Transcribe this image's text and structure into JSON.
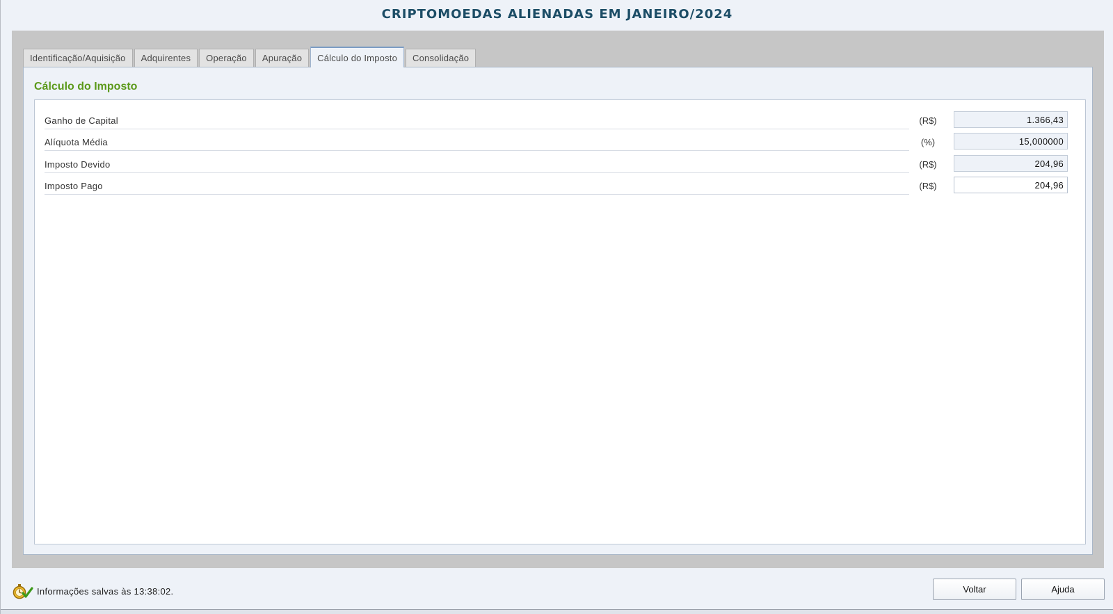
{
  "window": {
    "title": "CRIPTOMOEDAS ALIENADAS EM JANEIRO/2024"
  },
  "tabs": [
    {
      "label": "Identificação/Aquisição",
      "active": false
    },
    {
      "label": "Adquirentes",
      "active": false
    },
    {
      "label": "Operação",
      "active": false
    },
    {
      "label": "Apuração",
      "active": false
    },
    {
      "label": "Cálculo do Imposto",
      "active": true
    },
    {
      "label": "Consolidação",
      "active": false
    }
  ],
  "section": {
    "title": "Cálculo do Imposto"
  },
  "fields": [
    {
      "label": "Ganho de Capital",
      "unit": "(R$)",
      "value": "1.366,43",
      "editable": false
    },
    {
      "label": "Alíquota Média",
      "unit": "(%)",
      "value": "15,000000",
      "editable": false
    },
    {
      "label": "Imposto Devido",
      "unit": "(R$)",
      "value": "204,96",
      "editable": false
    },
    {
      "label": "Imposto Pago",
      "unit": "(R$)",
      "value": "204,96",
      "editable": true
    }
  ],
  "status": {
    "text": "Informações salvas às 13:38:02.",
    "icon": "saved-check-icon"
  },
  "buttons": {
    "voltar": "Voltar",
    "ajuda": "Ajuda"
  },
  "colors": {
    "title": "#1c4d66",
    "section_title": "#5c9a1b",
    "tab_active_border": "#7b9cc4"
  }
}
